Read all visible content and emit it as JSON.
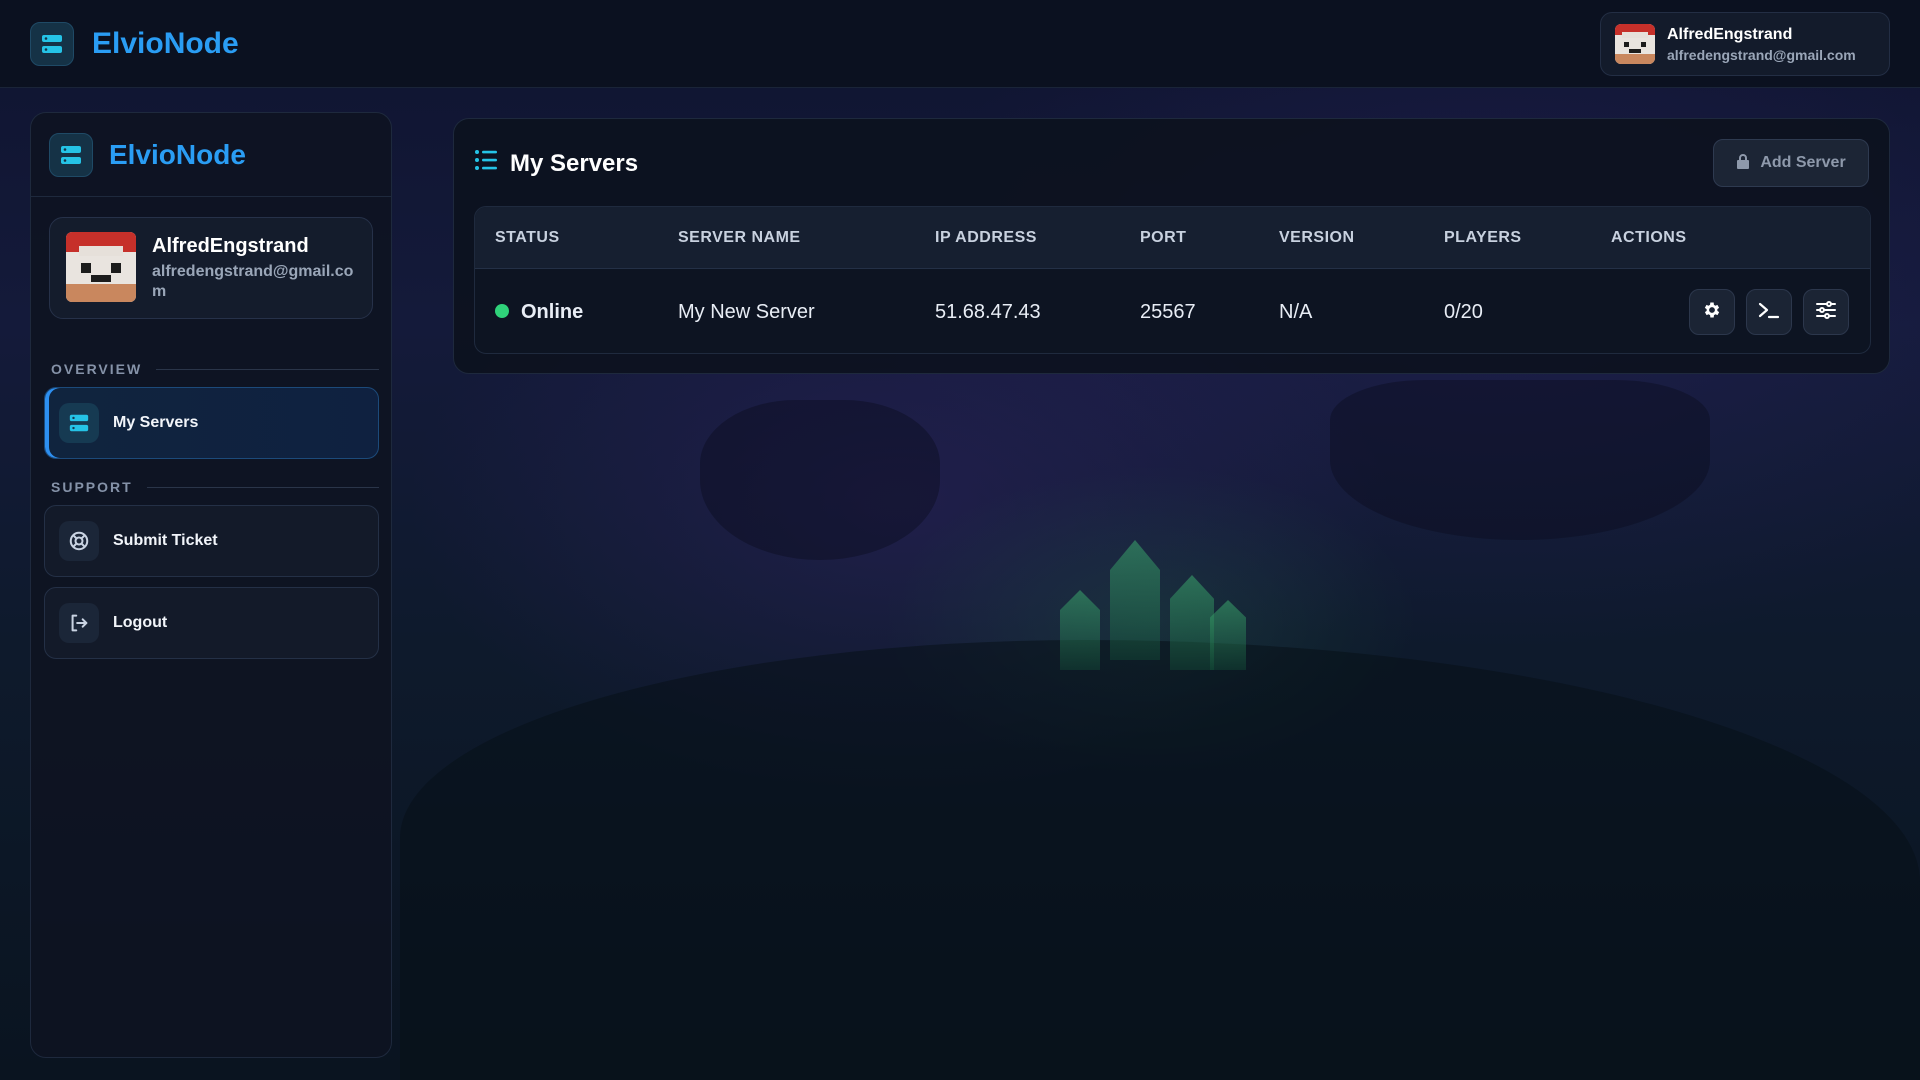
{
  "topbar": {
    "brand": "ElvioNode",
    "brand_icon": "server-icon",
    "user": {
      "name": "AlfredEngstrand",
      "email": "alfredengstrand@gmail.com"
    }
  },
  "sidebar": {
    "brand": "ElvioNode",
    "user": {
      "name": "AlfredEngstrand",
      "email": "alfredengstrand@gmail.com"
    },
    "sections": [
      {
        "label": "OVERVIEW",
        "items": [
          {
            "label": "My Servers",
            "icon": "server-icon",
            "active": true
          }
        ]
      },
      {
        "label": "SUPPORT",
        "items": [
          {
            "label": "Submit Ticket",
            "icon": "lifebuoy-icon",
            "active": false
          },
          {
            "label": "Logout",
            "icon": "logout-icon",
            "active": false
          }
        ]
      }
    ]
  },
  "main": {
    "title": "My Servers",
    "title_icon": "list-icon",
    "add_button": {
      "label": "Add Server",
      "icon": "lock-icon"
    },
    "table": {
      "columns": [
        "STATUS",
        "SERVER NAME",
        "IP ADDRESS",
        "PORT",
        "VERSION",
        "PLAYERS",
        "ACTIONS"
      ],
      "rows": [
        {
          "status": "Online",
          "server_name": "My New Server",
          "ip": "51.68.47.43",
          "port": "25567",
          "version": "N/A",
          "players": "0/20",
          "actions": [
            "gear-icon",
            "terminal-icon",
            "sliders-icon"
          ]
        }
      ]
    }
  },
  "colors": {
    "accent": "#2a9df4",
    "online": "#2fd27a",
    "background": "#0b1120"
  }
}
